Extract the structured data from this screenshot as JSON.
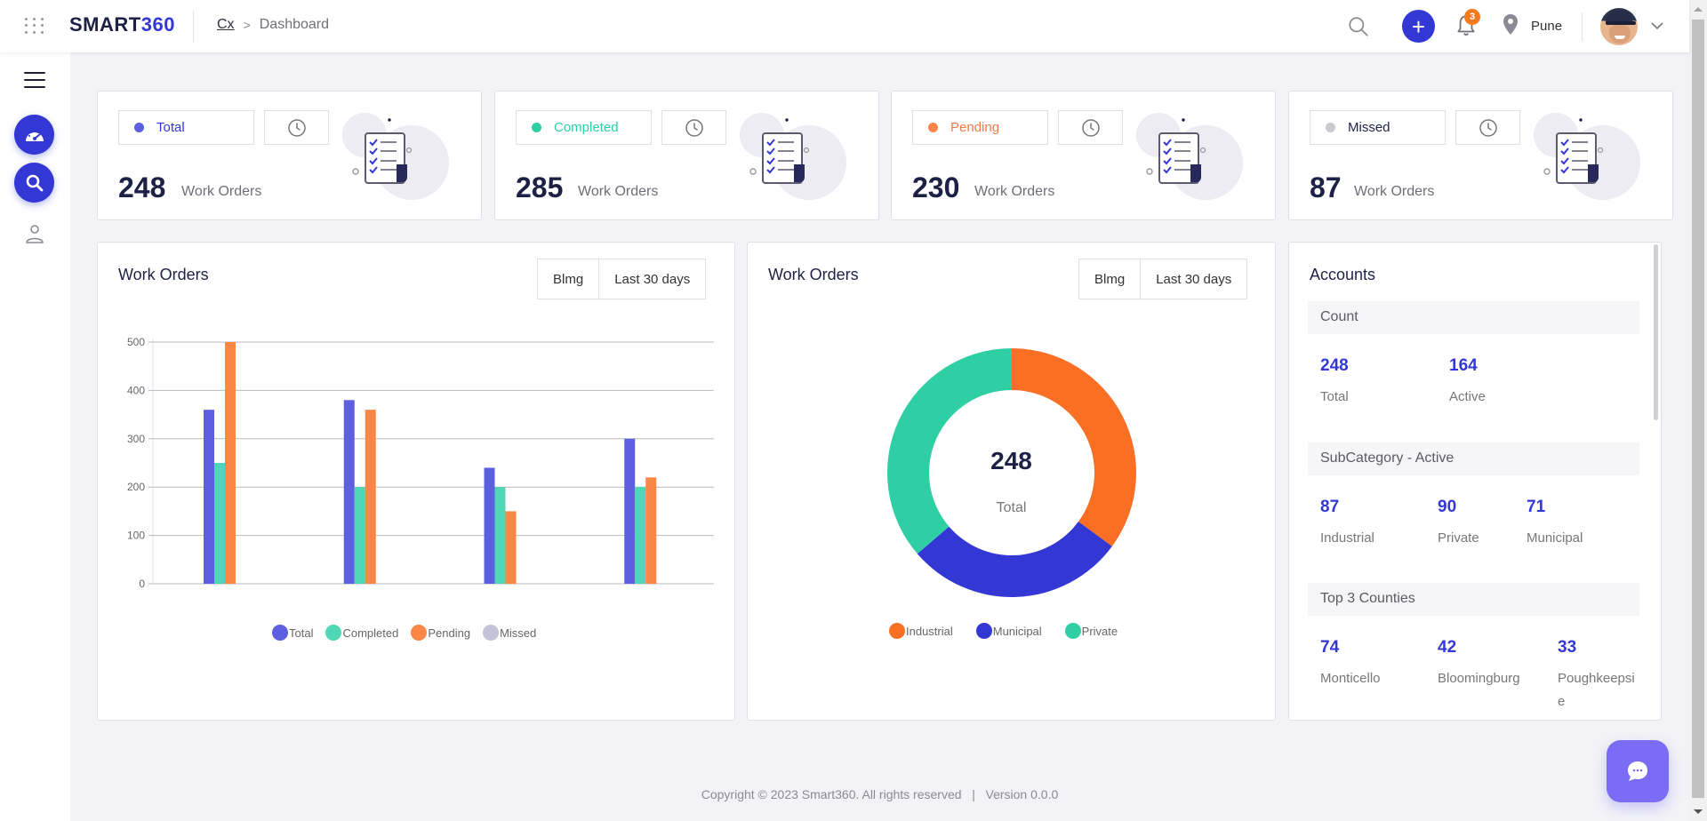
{
  "header": {
    "logo_part1": "SMART",
    "logo_part2": "360",
    "breadcrumb": {
      "parent": "Cx",
      "separator": ">",
      "current": "Dashboard"
    },
    "notification_count": "3",
    "location": "Pune",
    "icons": [
      "apps-grid-icon",
      "search-icon",
      "plus-icon",
      "bell-icon",
      "map-pin-icon",
      "avatar",
      "chevron-down-icon"
    ]
  },
  "sidebar": {
    "items": [
      {
        "name": "menu-toggle",
        "icon": "hamburger-icon"
      },
      {
        "name": "dashboard",
        "icon": "speedometer-icon",
        "active": true
      },
      {
        "name": "search",
        "icon": "search-icon",
        "active": true
      },
      {
        "name": "users",
        "icon": "user-icon"
      }
    ]
  },
  "stat_cards": [
    {
      "label": "Total",
      "value": "248",
      "unit": "Work Orders",
      "color": "#5b5fe0",
      "label_color": "#3338d5"
    },
    {
      "label": "Completed",
      "value": "285",
      "unit": "Work Orders",
      "color": "#2ecfa4",
      "label_color": "#2ecfa4"
    },
    {
      "label": "Pending",
      "value": "230",
      "unit": "Work Orders",
      "color": "#f9854a",
      "label_color": "#f47a4a"
    },
    {
      "label": "Missed",
      "value": "87",
      "unit": "Work Orders",
      "color": "#c9c9cf",
      "label_color": "#1e2146"
    }
  ],
  "bar_panel": {
    "title": "Work Orders",
    "filters": [
      "Blmg",
      "Last 30 days"
    ]
  },
  "donut_panel": {
    "title": "Work Orders",
    "filters": [
      "Blmg",
      "Last 30 days"
    ],
    "center_value": "248",
    "center_label": "Total"
  },
  "accounts": {
    "title": "Accounts",
    "sections": [
      {
        "title": "Count",
        "items": [
          {
            "value": "248",
            "label": "Total"
          },
          {
            "value": "164",
            "label": "Active"
          }
        ]
      },
      {
        "title": "SubCategory - Active",
        "items": [
          {
            "value": "87",
            "label": "Industrial"
          },
          {
            "value": "90",
            "label": "Private"
          },
          {
            "value": "71",
            "label": "Municipal"
          }
        ]
      },
      {
        "title": "Top 3 Counties",
        "items": [
          {
            "value": "74",
            "label": "Monticello"
          },
          {
            "value": "42",
            "label": "Bloomingburg"
          },
          {
            "value": "33",
            "label": "Poughkeepsie"
          }
        ]
      }
    ]
  },
  "footer": {
    "copyright": "Copyright © 2023 Smart360. All rights reserved",
    "separator": "|",
    "version": "Version 0.0.0"
  },
  "chat": {
    "icon": "chat-bubble-icon"
  },
  "chart_data": [
    {
      "type": "bar",
      "title": "Work Orders",
      "categories": [
        "",
        "",
        "",
        ""
      ],
      "series": [
        {
          "name": "Total",
          "color": "#5b5fe0",
          "values": [
            360,
            380,
            240,
            300
          ]
        },
        {
          "name": "Completed",
          "color": "#4fd6b4",
          "values": [
            250,
            200,
            200,
            200
          ]
        },
        {
          "name": "Pending",
          "color": "#fb8746",
          "values": [
            500,
            360,
            150,
            220
          ]
        },
        {
          "name": "Missed",
          "color": "#c2c3d8",
          "values": [
            0,
            0,
            0,
            0
          ]
        }
      ],
      "yticks": [
        0,
        100,
        200,
        300,
        400,
        500
      ],
      "ylim": [
        0,
        500
      ],
      "xlabel": "",
      "ylabel": "",
      "grid": true,
      "legend": "bottom"
    },
    {
      "type": "pie",
      "title": "Work Orders",
      "donut": true,
      "labels": [
        "Industrial",
        "Municipal",
        "Private"
      ],
      "values": [
        87,
        71,
        90
      ],
      "colors": [
        "#fb6f24",
        "#3338d5",
        "#2ecfa4"
      ],
      "center_value": "248",
      "center_label": "Total",
      "legend": "bottom"
    }
  ]
}
